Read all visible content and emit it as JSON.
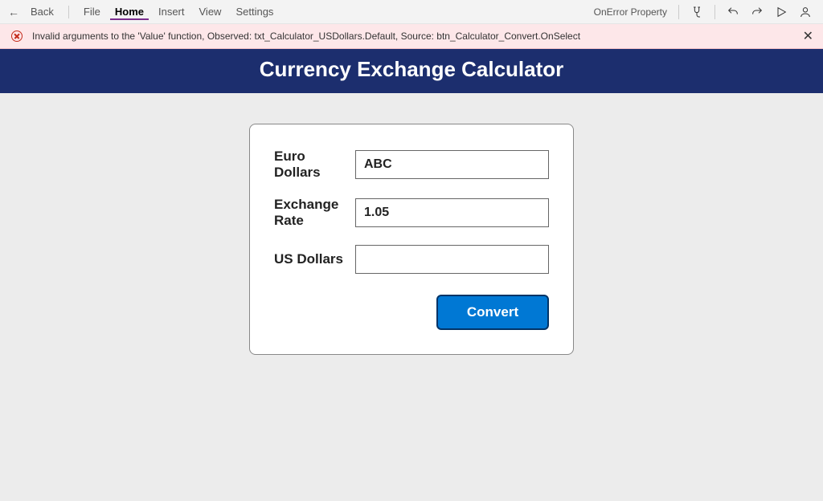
{
  "topbar": {
    "back_label": "Back",
    "menu": {
      "file": "File",
      "home": "Home",
      "insert": "Insert",
      "view": "View",
      "settings": "Settings"
    },
    "property_label": "OnError Property"
  },
  "error": {
    "message": "Invalid arguments to the 'Value' function, Observed: txt_Calculator_USDollars.Default, Source: btn_Calculator_Convert.OnSelect"
  },
  "app": {
    "title": "Currency Exchange Calculator"
  },
  "form": {
    "euro_label": "Euro Dollars",
    "euro_value": "ABC",
    "rate_label": "Exchange Rate",
    "rate_value": "1.05",
    "usd_label": "US Dollars",
    "usd_value": "",
    "convert_label": "Convert"
  }
}
